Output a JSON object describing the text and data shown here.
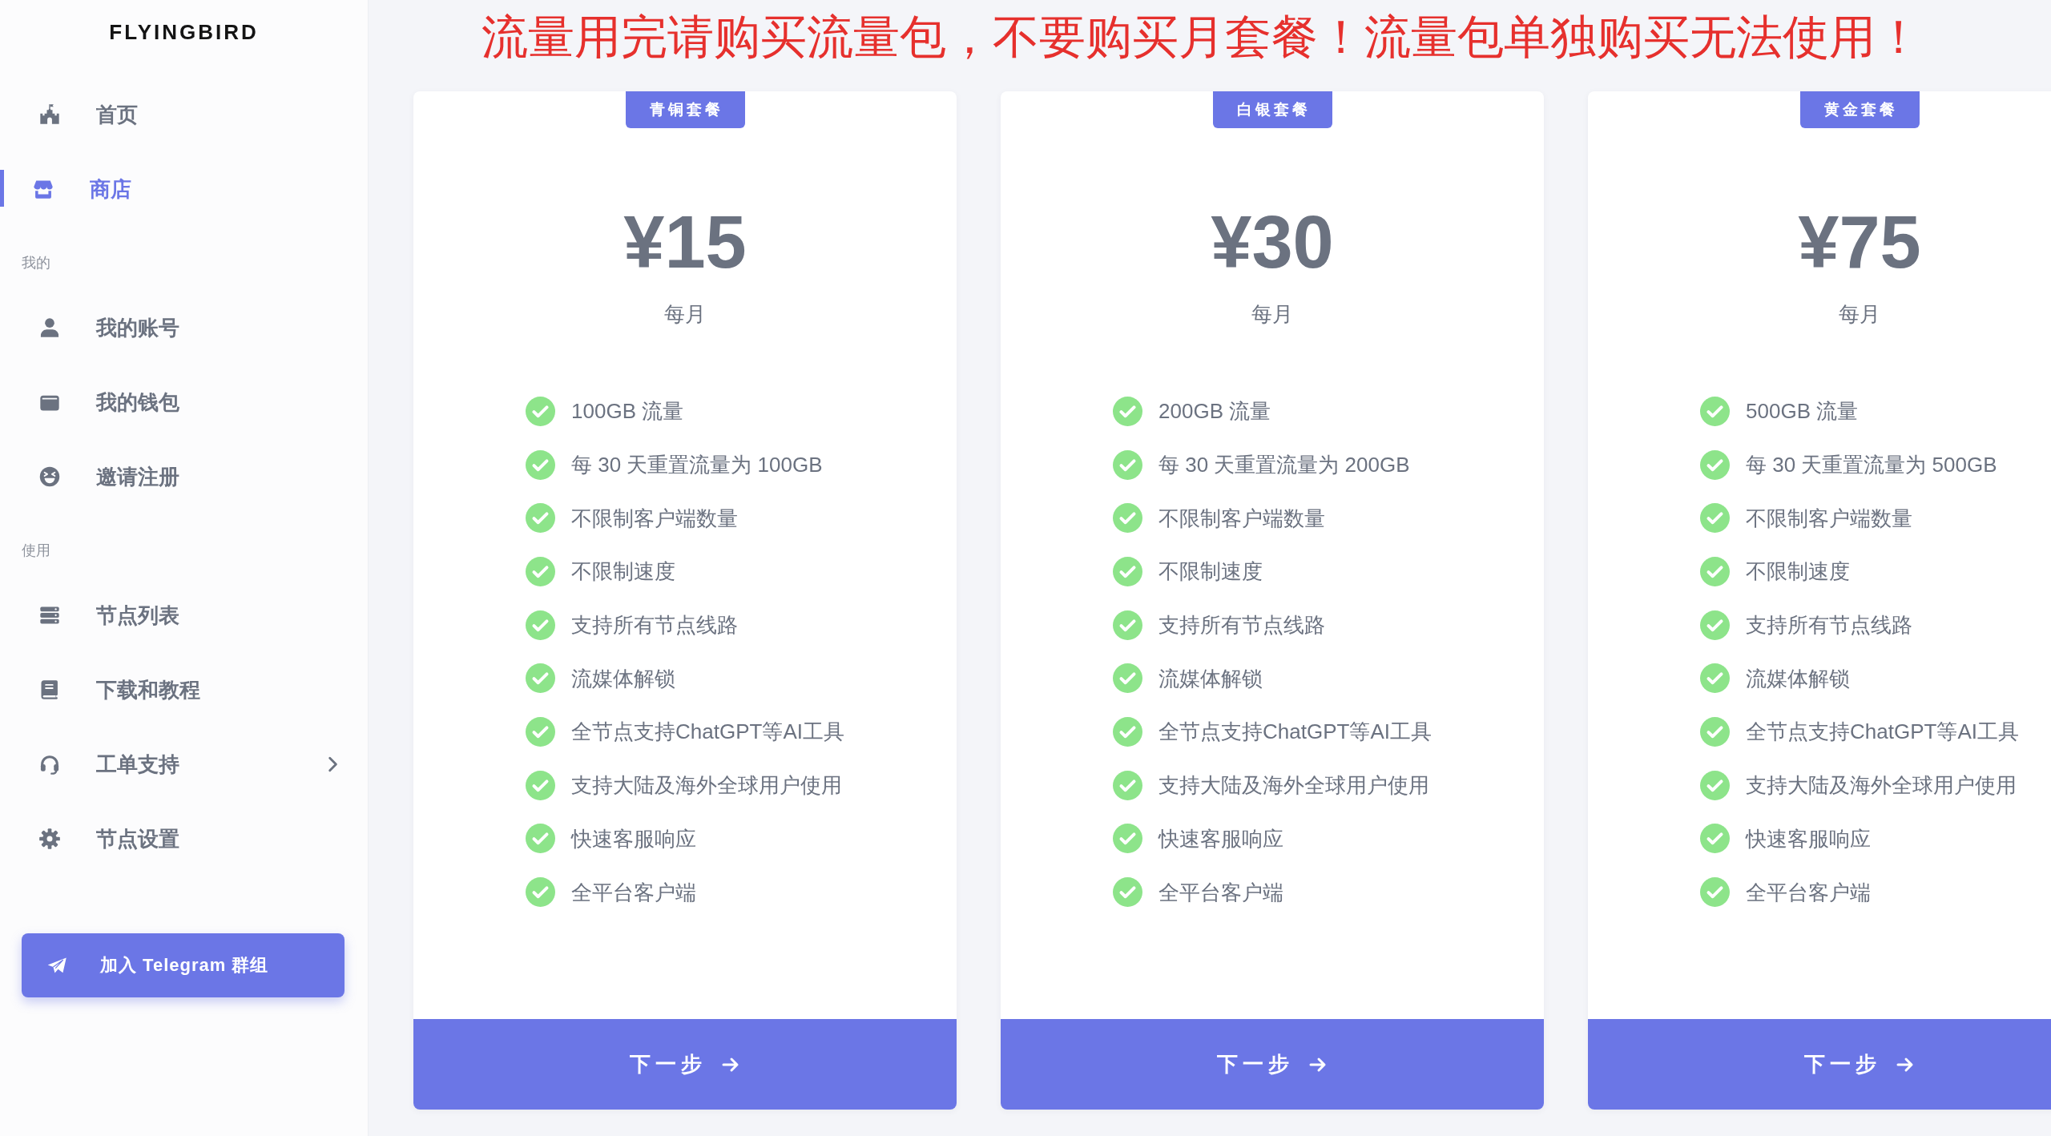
{
  "sidebar": {
    "logo": "FLYINGBIRD",
    "sections": [
      {
        "items": [
          {
            "label": "首页",
            "kind": "page",
            "selected": false
          },
          {
            "label": "商店",
            "kind": "page",
            "selected": true
          }
        ]
      },
      {
        "heading": "我的",
        "items": [
          {
            "label": "我的账号",
            "kind": "page",
            "selected": false
          },
          {
            "label": "我的钱包",
            "kind": "page",
            "selected": false
          },
          {
            "label": "邀请注册",
            "kind": "page",
            "selected": false
          }
        ]
      },
      {
        "heading": "使用",
        "items": [
          {
            "label": "节点列表",
            "kind": "page",
            "selected": false
          },
          {
            "label": "下载和教程",
            "kind": "page",
            "selected": false
          },
          {
            "label": "工单支持",
            "kind": "submenu",
            "selected": false
          },
          {
            "label": "节点设置",
            "kind": "page",
            "selected": false
          }
        ]
      }
    ],
    "join_button": "加入 Telegram 群组"
  },
  "notice": "流量用完请购买流量包，不要购买月套餐！流量包单独购买无法使用！",
  "plans": [
    {
      "badge": "青铜套餐",
      "price": "¥15",
      "period": "每月",
      "features": [
        "100GB 流量",
        "每 30 天重置流量为 100GB",
        "不限制客户端数量",
        "不限制速度",
        "支持所有节点线路",
        "流媒体解锁",
        "全节点支持ChatGPT等AI工具",
        "支持大陆及海外全球用户使用",
        "快速客服响应",
        "全平台客户端"
      ],
      "button": "下一步"
    },
    {
      "badge": "白银套餐",
      "price": "¥30",
      "period": "每月",
      "features": [
        "200GB 流量",
        "每 30 天重置流量为 200GB",
        "不限制客户端数量",
        "不限制速度",
        "支持所有节点线路",
        "流媒体解锁",
        "全节点支持ChatGPT等AI工具",
        "支持大陆及海外全球用户使用",
        "快速客服响应",
        "全平台客户端"
      ],
      "button": "下一步"
    },
    {
      "badge": "黄金套餐",
      "price": "¥75",
      "period": "每月",
      "features": [
        "500GB 流量",
        "每 30 天重置流量为 500GB",
        "不限制客户端数量",
        "不限制速度",
        "支持所有节点线路",
        "流媒体解锁",
        "全节点支持ChatGPT等AI工具",
        "支持大陆及海外全球用户使用",
        "快速客服响应",
        "全平台客户端"
      ],
      "button": "下一步"
    }
  ]
}
